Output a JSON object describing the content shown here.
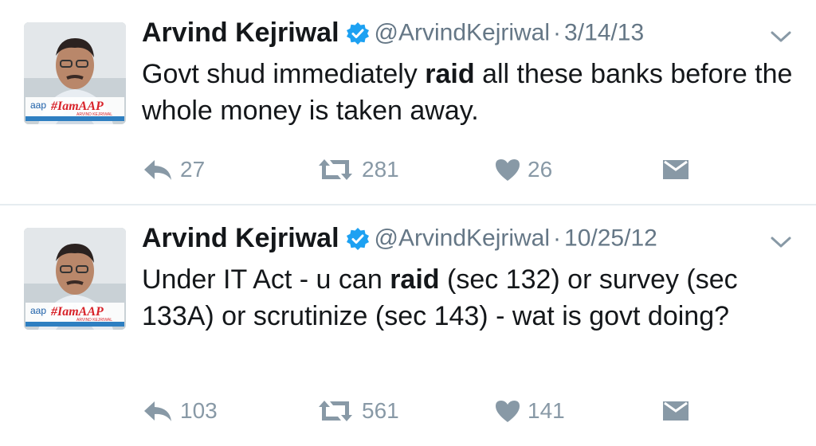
{
  "tweets": [
    {
      "name": "Arvind Kejriwal",
      "handle": "@ArvindKejriwal",
      "separator": "·",
      "date": "3/14/13",
      "body": [
        {
          "text": "Govt shud immediately ",
          "bold": false
        },
        {
          "text": "raid",
          "bold": true
        },
        {
          "text": " all these banks before the whole money is taken away.",
          "bold": false
        }
      ],
      "replies": "27",
      "retweets": "281",
      "likes": "26"
    },
    {
      "name": "Arvind Kejriwal",
      "handle": "@ArvindKejriwal",
      "separator": "·",
      "date": "10/25/12",
      "body": [
        {
          "text": "Under IT Act - u can ",
          "bold": false
        },
        {
          "text": "raid",
          "bold": true
        },
        {
          "text": " (sec 132) or survey (sec 133A) or scrutinize (sec 143) - wat is govt doing?",
          "bold": false
        }
      ],
      "replies": "103",
      "retweets": "561",
      "likes": "141"
    }
  ],
  "avatar_badge": {
    "logo": "aap",
    "tag": "#IamAAP",
    "subtext": "ARVIND KEJRIWAL"
  },
  "icons": [
    "verified-badge-icon",
    "chevron-down-icon",
    "reply-icon",
    "retweet-icon",
    "like-heart-icon",
    "direct-message-icon"
  ],
  "colors": {
    "text": "#14171a",
    "secondary": "#657786",
    "action": "#8899a6",
    "verified": "#1da1f2",
    "divider": "#e6ecf0"
  }
}
